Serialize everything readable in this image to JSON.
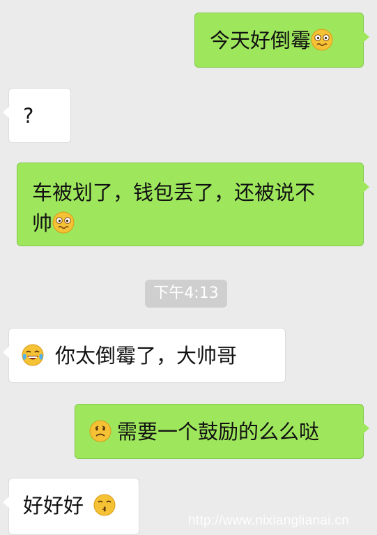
{
  "chat": {
    "messages": [
      {
        "direction": "out",
        "text": "今天好倒霉",
        "emoji": "woozy-face-icon"
      },
      {
        "direction": "in",
        "text": "?"
      },
      {
        "direction": "out",
        "text_line1": "车被划了，钱包丢了，还被说不",
        "text_line2": "帅",
        "emoji": "woozy-face-icon"
      },
      {
        "direction": "in",
        "text": "你太倒霉了，大帅哥",
        "emoji": "tears-of-joy-icon"
      },
      {
        "direction": "out",
        "text": "需要一个鼓励的么么哒",
        "emoji": "slightly-frowning-face-icon"
      },
      {
        "direction": "in",
        "text": "好好好",
        "emoji": "kissing-face-icon"
      }
    ],
    "timestamp": "下午4:13"
  },
  "watermark": "http://www.nixianglianai.cn",
  "colors": {
    "background": "#ebebeb",
    "outgoing_bubble": "#9ee75d",
    "incoming_bubble": "#ffffff",
    "timestamp_pill": "#cfcfcf"
  }
}
